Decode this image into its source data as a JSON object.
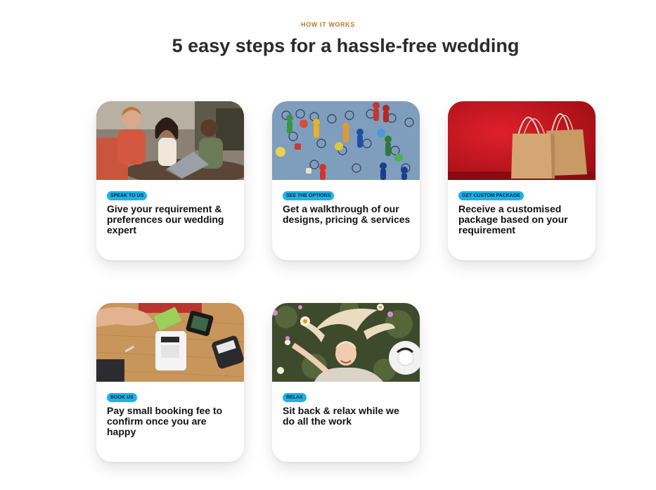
{
  "header": {
    "eyebrow": "HOW IT WORKS",
    "title": "5 easy steps for a hassle-free wedding"
  },
  "steps": [
    {
      "badge": "SPEAK TO US",
      "text": "Give your requirement & preferences our wedding expert",
      "image": "people-meeting-at-laptop-photo"
    },
    {
      "badge": "SEE THE OPTIONS",
      "text": "Get a walkthrough of our designs, pricing & services",
      "image": "board-game-pieces-photo"
    },
    {
      "badge": "GET CUSTOM PACKAGE",
      "text": "Receive a customised package based on your requirement",
      "image": "gift-bags-on-red-photo"
    },
    {
      "badge": "BOOK US",
      "text": "Pay small booking fee to confirm once you are happy",
      "image": "card-payment-terminal-photo"
    },
    {
      "badge": "RELAX",
      "text": "Sit back & relax while we do all the work",
      "image": "woman-relaxing-on-grass-photo"
    }
  ],
  "colors": {
    "accent": "#c4742b",
    "badge": "#1eb1ea"
  }
}
